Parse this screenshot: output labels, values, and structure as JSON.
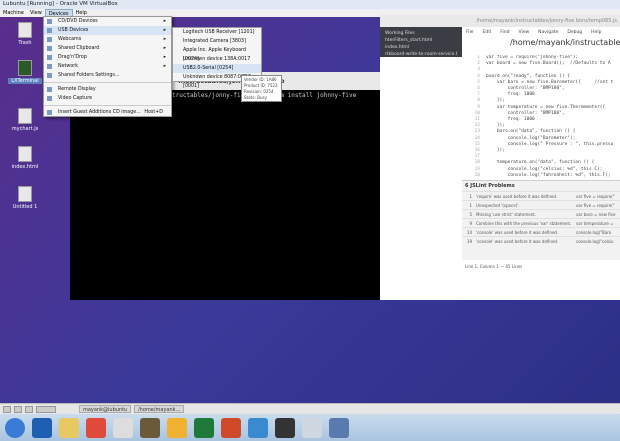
{
  "vm": {
    "title": "Lubuntu [Running] - Oracle VM VirtualBox",
    "menu": [
      "Machine",
      "View",
      "Devices",
      "Help"
    ]
  },
  "desktop_icons": [
    "Trash",
    "LXTerminal",
    "mychart.js",
    "index.html",
    "Untitled 1"
  ],
  "devices_menu": [
    {
      "label": "CD/DVD Devices",
      "sub": true
    },
    {
      "label": "USB Devices",
      "sub": true,
      "highlight": true
    },
    {
      "label": "Webcams",
      "sub": true
    },
    {
      "label": "Shared Clipboard",
      "sub": true
    },
    {
      "label": "Drag'n'Drop",
      "sub": true
    },
    {
      "label": "Network",
      "sub": true
    },
    {
      "label": "Shared Folders Settings..."
    },
    {
      "sep": true
    },
    {
      "label": "Remote Display"
    },
    {
      "label": "Video Capture"
    },
    {
      "sep": true
    },
    {
      "label": "Insert Guest Additions CD image...",
      "shortcut": "Host+D"
    }
  ],
  "usb_menu": [
    "Logitech USB Receiver [1201]",
    "Integrated Camera [3803]",
    "Apple Inc. Apple Keyboard [0074]",
    "Unknown device 138A:0017 [0078]",
    "USB2.0-Serial [0254]",
    "Unknown device 8087:07DC [0001]"
  ],
  "usb_highlight": 4,
  "tooltip": [
    "Vendor ID: 1A86",
    "Product ID: 7523",
    "Revision: 0254",
    "State: Busy"
  ],
  "terminal": {
    "title": "...structables/jonny-five boro",
    "controls": "– + ✕",
    "line": "tructables/jonny-five boro$ npm install johnny-five"
  },
  "brackets": {
    "title": "/home/mayank/instructables/jonny-five boro/temp085.js",
    "working_files_label": "Working Files",
    "files": [
      "hterFilters_start.html",
      "index.html",
      "rtkboard-write-to-room-service.html"
    ],
    "menu": [
      "File",
      "Edit",
      "Find",
      "View",
      "Navigate",
      "Debug",
      "Help"
    ],
    "path": "/home/mayank/instructables",
    "code": [
      "var five = require(\"johnny-five\");",
      "var board = new five.Board();  //Defaults to A",
      "",
      "board.on(\"ready\", function () {",
      "    var baro = new five.Barometer({     //set t",
      "        controller: \"BMP180\",",
      "        freq: 1000",
      "    });",
      "    var temperature = new five.Thermometer({  ",
      "        controller: \"BMP180\",",
      "        freq: 1000",
      "    });",
      "    baro.on(\"data\", function () {",
      "        console.log(\"Barometer\");",
      "        console.log(\" Pressure : \", this.pressu",
      "    });",
      "",
      "    temperature.on(\"data\", function () {",
      "        console.log(\"celsius: %d\", this.C);",
      "        console.log(\"fahrenheit: %d\", this.F);"
    ],
    "lint_title": "6 JSLint Problems",
    "lint": [
      {
        "line": "1",
        "msg": "'require' was used before it was defined.",
        "code": "var five = require(\""
      },
      {
        "line": "1",
        "msg": "Unexpected '(space)'.",
        "code": "var five = require(\""
      },
      {
        "line": "5",
        "msg": "Missing 'use strict' statement.",
        "code": "var baro = new five"
      },
      {
        "line": "9",
        "msg": "Combine this with the previous 'var' statement.",
        "code": "var temperature = "
      },
      {
        "line": "14",
        "msg": "'console' was used before it was defined.",
        "code": "console.log(\"Baro"
      },
      {
        "line": "19",
        "msg": "'console' was used before it was defined.",
        "code": "console.log(\"celsiu"
      }
    ],
    "status": "Line 1, Column 1 — 45 Lines"
  },
  "guest_taskbar": [
    "mayank@lubuntu",
    "/home/mayank..."
  ],
  "windows_taskbar": [
    "start",
    "outlook",
    "explorer",
    "chrome",
    "calculator",
    "app",
    "app2",
    "excel",
    "powerpoint",
    "remote",
    "headset",
    "notepad",
    "virtualbox"
  ]
}
